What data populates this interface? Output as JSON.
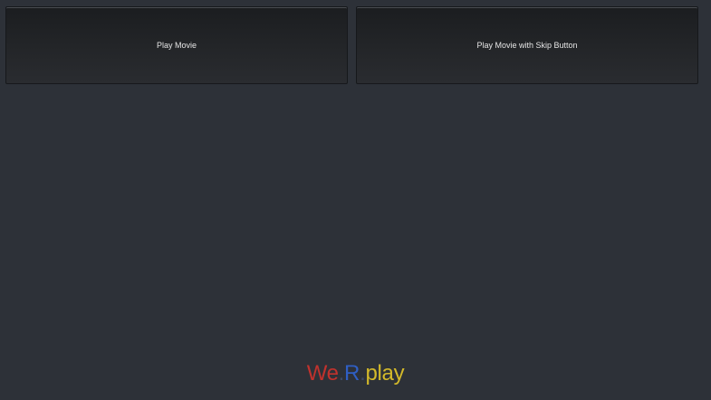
{
  "buttons": {
    "play_movie": "Play Movie",
    "play_movie_skip": "Play Movie with Skip Button"
  },
  "logo": {
    "part1": "We",
    "dot1": ".",
    "part2": "R",
    "dot2": ".",
    "part3": "play",
    "colors": {
      "we": "#c0322d",
      "dot": "#3d4a66",
      "r": "#2f5fc4",
      "play": "#d3b92a"
    }
  },
  "colors": {
    "background": "#2d3138",
    "button_text": "#e6e6e6"
  }
}
